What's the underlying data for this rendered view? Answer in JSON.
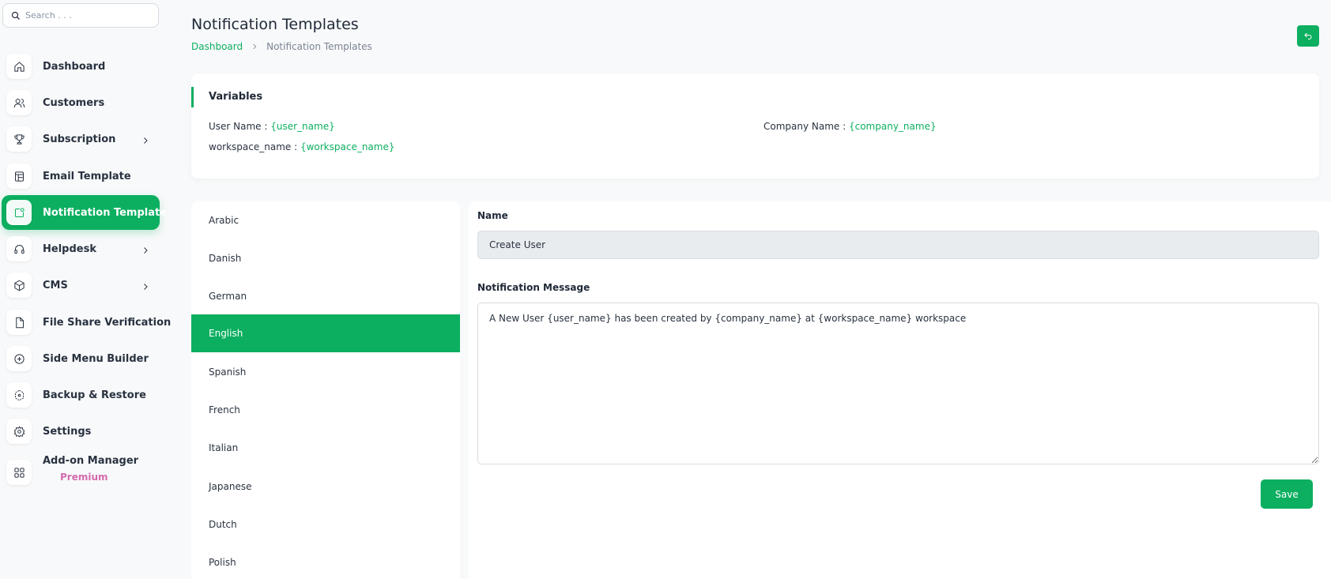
{
  "search": {
    "placeholder": "Search . . ."
  },
  "sidebar": {
    "items": [
      {
        "label": "Dashboard",
        "icon": "home-icon"
      },
      {
        "label": "Customers",
        "icon": "users-icon"
      },
      {
        "label": "Subscription",
        "icon": "trophy-icon",
        "has_submenu": true
      },
      {
        "label": "Email Template",
        "icon": "template-icon"
      },
      {
        "label": "Notification Template",
        "icon": "notification-icon",
        "active": true
      },
      {
        "label": "Helpdesk",
        "icon": "headset-icon",
        "has_submenu": true
      },
      {
        "label": "CMS",
        "icon": "cube-icon",
        "has_submenu": true
      },
      {
        "label": "File Share Verification",
        "icon": "file-icon"
      },
      {
        "label": "Side Menu Builder",
        "icon": "plus-circle-icon"
      },
      {
        "label": "Backup & Restore",
        "icon": "backup-icon"
      },
      {
        "label": "Settings",
        "icon": "gear-icon"
      },
      {
        "label": "Add-on Manager",
        "icon": "apps-icon",
        "badge": "Premium"
      }
    ]
  },
  "header": {
    "title": "Notification Templates",
    "breadcrumb": {
      "link": "Dashboard",
      "current": "Notification Templates"
    },
    "back_icon": "back-arrow-icon"
  },
  "variables": {
    "title": "Variables",
    "items": [
      {
        "label": "User Name : ",
        "token": "{user_name}"
      },
      {
        "label": "Company Name : ",
        "token": "{company_name}"
      },
      {
        "label": "workspace_name : ",
        "token": "{workspace_name}"
      }
    ]
  },
  "languages": [
    "Arabic",
    "Danish",
    "German",
    "English",
    "Spanish",
    "French",
    "Italian",
    "Japanese",
    "Dutch",
    "Polish"
  ],
  "selected_language": "English",
  "form": {
    "name_label": "Name",
    "name_value": "Create User",
    "message_label": "Notification Message",
    "message_value": "A New User {user_name} has been created by {company_name} at {workspace_name} workspace",
    "save_label": "Save"
  },
  "colors": {
    "accent": "#0caf60",
    "premium": "#d46aad",
    "background": "#f8f9fa"
  }
}
